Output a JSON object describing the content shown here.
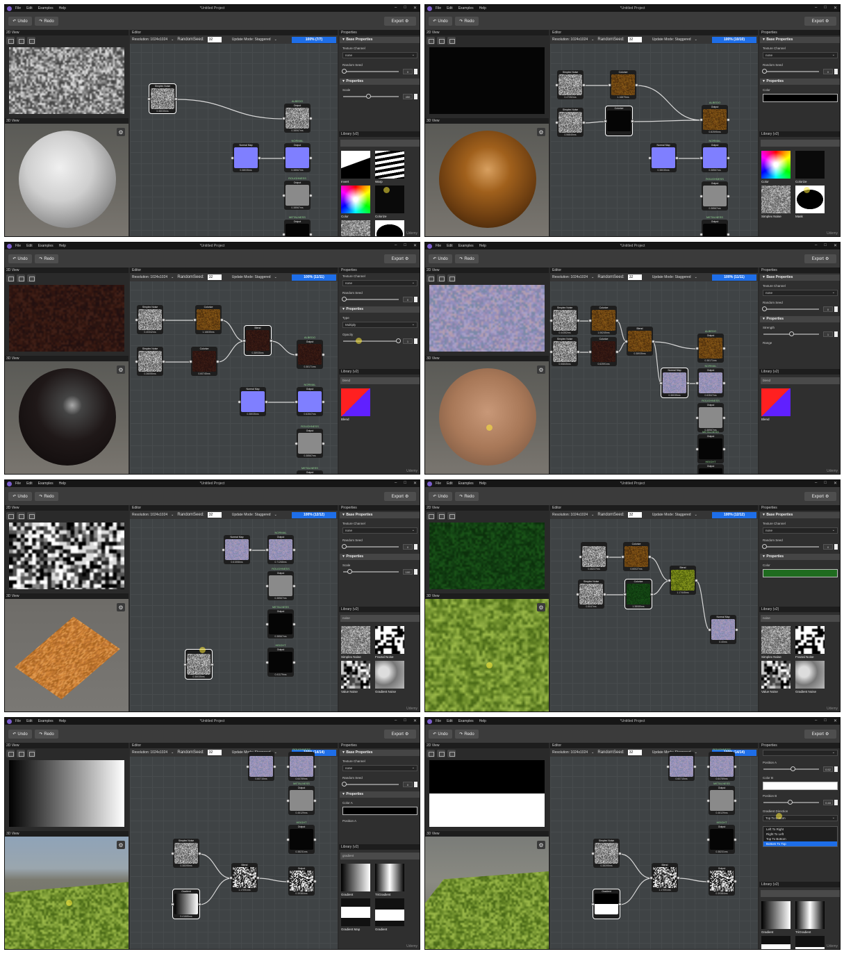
{
  "window": {
    "title": "*Untitled Project",
    "menu": [
      "File",
      "Edit",
      "Examples",
      "Help"
    ],
    "controls": [
      "–",
      "□",
      "✕"
    ]
  },
  "toolbar": {
    "undo_label": "Undo",
    "redo_label": "Redo",
    "export_label": "Export"
  },
  "sections": {
    "view2d": "2D View",
    "view3d": "3D View",
    "editor": "Editor",
    "properties": "Properties",
    "library": "Library (v2)"
  },
  "editor_bar": {
    "resolution": "Resolution: 1024x1024",
    "seed_label": "RandomSeed:",
    "seed_value": "32",
    "update_mode": "Update Mode: Staggered"
  },
  "watermark": "Udemy",
  "colors": {
    "accent_blue": "#1e6ee8",
    "normal_blue": "#7f7fff",
    "editor_bg": "#3f4345",
    "panel_bg": "#2b2b2b"
  },
  "panels": [
    {
      "progress": "100% (7/7)",
      "tex": "noise-gray",
      "sphere": "sphere-white",
      "model": "sphere",
      "props": [
        {
          "t": "sec",
          "label": "▼ Base Properties"
        },
        {
          "t": "lbl",
          "label": "Texture Channel"
        },
        {
          "t": "drop",
          "value": "none"
        },
        {
          "t": "lbl",
          "label": "Random Seed"
        },
        {
          "t": "slider",
          "value": "0",
          "f": 0.0
        },
        {
          "t": "sec",
          "label": "▼ Properties"
        },
        {
          "t": "lbl",
          "label": "Scale"
        },
        {
          "t": "slider",
          "value": "450",
          "f": 0.45
        }
      ],
      "library": {
        "search": "",
        "items": [
          {
            "label": "Invert",
            "thumb": "invert-thumb"
          },
          {
            "label": "Warp",
            "thumb": "warp-thumb"
          },
          {
            "label": "Color",
            "thumb": "color-wheel-thumb"
          },
          {
            "label": "Colorize",
            "thumb": "colorize-thumb"
          },
          {
            "label": "",
            "thumb": "noise-thumb"
          },
          {
            "label": "",
            "thumb": "mask-thumb"
          }
        ]
      },
      "cursor": "library",
      "nodes": [
        {
          "title": "Simplex Noise",
          "value": "0.38035ms",
          "preview": "noise-gray",
          "sel": true
        },
        {
          "title": "Output",
          "value": "0.38567ms",
          "preview": "noise-gray",
          "label": "ALBEDO"
        },
        {
          "title": "Normal Map",
          "value": "0.38035ms",
          "preview": "normal-blue"
        },
        {
          "title": "Output",
          "value": "0.38567ms",
          "preview": "normal-blue",
          "label": "NORMAL"
        },
        {
          "title": "Output",
          "value": "0.38567ms",
          "preview": "gray",
          "label": "ROUGHNESS"
        },
        {
          "title": "Output",
          "value": "",
          "preview": "black",
          "label": "METALNESS"
        }
      ]
    },
    {
      "progress": "100% (10/10)",
      "tex": "black",
      "sphere": "sphere-brown",
      "model": "sphere",
      "props": [
        {
          "t": "sec",
          "label": "▼ Base Properties"
        },
        {
          "t": "lbl",
          "label": "Texture Channel"
        },
        {
          "t": "drop",
          "value": "none"
        },
        {
          "t": "lbl",
          "label": "Random Seed"
        },
        {
          "t": "slider",
          "value": "0",
          "f": 0.0
        },
        {
          "t": "sec",
          "label": "▼ Properties"
        },
        {
          "t": "lbl",
          "label": "Color"
        },
        {
          "t": "color",
          "value": "#000000"
        }
      ],
      "library": {
        "search": "",
        "items": [
          {
            "label": "Color",
            "thumb": "color-wheel-thumb"
          },
          {
            "label": "Colorize",
            "thumb": "colorize-thumb"
          },
          {
            "label": "Simplex Noise",
            "thumb": "noise-thumb"
          },
          {
            "label": "Mask",
            "thumb": "mask-thumb"
          }
        ]
      },
      "cursor": "library",
      "nodes": [
        {
          "title": "Simplex Noise",
          "value": "0.47352ms",
          "preview": "noise-gray"
        },
        {
          "title": "Colorize",
          "value": "1.16879ms",
          "preview": "brown"
        },
        {
          "title": "Simplex Noise",
          "value": "0.56845ms",
          "preview": "noise-gray"
        },
        {
          "title": "Colorize",
          "value": "",
          "preview": "black",
          "sel": true
        },
        {
          "title": "Output",
          "value": "0.82595ms",
          "preview": "brown",
          "label": "ALBEDO"
        },
        {
          "title": "Normal Map",
          "value": "0.38035ms",
          "preview": "normal-blue"
        },
        {
          "title": "Output",
          "value": "0.38567ms",
          "preview": "normal-blue",
          "label": "NORMAL"
        },
        {
          "title": "Output",
          "value": "0.38567ms",
          "preview": "gray",
          "label": "ROUGHNESS"
        },
        {
          "title": "Output",
          "value": "",
          "preview": "black",
          "label": "METALNESS"
        }
      ]
    },
    {
      "progress": "100% (11/11)",
      "tex": "dark-red",
      "sphere": "sphere-dark",
      "model": "sphere",
      "props": [
        {
          "t": "lbl",
          "label": "Texture Channel"
        },
        {
          "t": "drop",
          "value": "none"
        },
        {
          "t": "lbl",
          "label": "Random Seed"
        },
        {
          "t": "slider",
          "value": "0",
          "f": 0.0
        },
        {
          "t": "sec",
          "label": "▼ Properties"
        },
        {
          "t": "lbl",
          "label": "Type"
        },
        {
          "t": "drop",
          "value": "Multiply"
        },
        {
          "t": "lbl",
          "label": "Opacity"
        },
        {
          "t": "slider",
          "value": "1",
          "f": 1.0
        }
      ],
      "library": {
        "search": "blend",
        "items": [
          {
            "label": "Blend",
            "thumb": "blend-thumb"
          }
        ]
      },
      "cursor": "props",
      "nodes": [
        {
          "title": "Simplex Noise",
          "value": "0.40342ms",
          "preview": "noise-gray"
        },
        {
          "title": "Colorize",
          "value": "1.16835ms",
          "preview": "brown"
        },
        {
          "title": "Blend",
          "value": "0.38935ms",
          "preview": "dark-red",
          "sel": true
        },
        {
          "title": "Output",
          "value": "0.38171ms",
          "preview": "dark-red",
          "label": "ALBEDO"
        },
        {
          "title": "Simplex Noise",
          "value": "0.36055ms",
          "preview": "noise-gray"
        },
        {
          "title": "Colorize",
          "value": "0.60745ms",
          "preview": "dark-red"
        },
        {
          "title": "Normal Map",
          "value": "0.38035ms",
          "preview": "normal-blue"
        },
        {
          "title": "Output",
          "value": "0.62847ms",
          "preview": "normal-blue",
          "label": "NORMAL"
        },
        {
          "title": "Output",
          "value": "0.38567ms",
          "preview": "gray",
          "label": "ROUGHNESS"
        },
        {
          "title": "Output",
          "value": "",
          "preview": "black",
          "label": "METALNESS"
        }
      ]
    },
    {
      "progress": "100% (11/11)",
      "tex": "noise-color",
      "sphere": "sphere-sand",
      "model": "sphere",
      "props": [
        {
          "t": "sec",
          "label": "▼ Base Properties"
        },
        {
          "t": "lbl",
          "label": "Texture Channel"
        },
        {
          "t": "drop",
          "value": "none"
        },
        {
          "t": "lbl",
          "label": "Random Seed"
        },
        {
          "t": "slider",
          "value": "0",
          "f": 0.0
        },
        {
          "t": "sec",
          "label": "▼ Properties"
        },
        {
          "t": "lbl",
          "label": "Strength"
        },
        {
          "t": "slider",
          "value": "1",
          "f": 0.5
        },
        {
          "t": "lbl",
          "label": "Range"
        }
      ],
      "library": {
        "search": "blend",
        "items": [
          {
            "label": "Blend",
            "thumb": "blend-thumb"
          }
        ]
      },
      "cursor": "view3d",
      "nodes": [
        {
          "title": "Simplex Noise",
          "value": "0.44352ms",
          "preview": "noise-gray"
        },
        {
          "title": "Colorize",
          "value": "1.06245ms",
          "preview": "brown"
        },
        {
          "title": "Simplex Noise",
          "value": "0.56845ms",
          "preview": "noise-gray"
        },
        {
          "title": "Colorize",
          "value": "0.62591ms",
          "preview": "dark-red"
        },
        {
          "title": "Blend",
          "value": "0.38935ms",
          "preview": "brown"
        },
        {
          "title": "Output",
          "value": "0.38171ms",
          "preview": "brown",
          "label": "ALBEDO"
        },
        {
          "title": "Normal Map",
          "value": "0.38035ms",
          "preview": "noise-color",
          "sel": true
        },
        {
          "title": "Output",
          "value": "0.62847ms",
          "preview": "noise-color",
          "label": "NORMAL"
        },
        {
          "title": "Output",
          "value": "0.38567ms",
          "preview": "gray",
          "label": "ROUGHNESS"
        },
        {
          "title": "Output",
          "value": "",
          "preview": "black",
          "label": "METALNESS"
        },
        {
          "title": "Output",
          "value": "",
          "preview": "black",
          "label": "HEIGHT"
        }
      ]
    },
    {
      "progress": "100% (12/12)",
      "tex": "noise-bw",
      "sphere": "plane-orange",
      "model": "plane",
      "props": [
        {
          "t": "sec",
          "label": "▼ Base Properties"
        },
        {
          "t": "lbl",
          "label": "Texture Channel"
        },
        {
          "t": "drop",
          "value": "none"
        },
        {
          "t": "lbl",
          "label": "Random Seed"
        },
        {
          "t": "slider",
          "value": "0",
          "f": 0.0
        },
        {
          "t": "sec",
          "label": "▼ Properties"
        },
        {
          "t": "lbl",
          "label": "Scale"
        },
        {
          "t": "slider",
          "value": "100",
          "f": 0.1
        }
      ],
      "library": {
        "search": "noise",
        "items": [
          {
            "label": "Simplex Noise",
            "thumb": "noise-thumb"
          },
          {
            "label": "Fractal Noise",
            "thumb": "fractal-thumb"
          },
          {
            "label": "Value Noise",
            "thumb": "value-thumb"
          },
          {
            "label": "Gradient Noise",
            "thumb": "gradnoise-thumb"
          }
        ]
      },
      "cursor": "editor",
      "nodes": [
        {
          "title": "Normal Map",
          "value": "0.61558ms",
          "preview": "noise-color"
        },
        {
          "title": "Output",
          "value": "0.71268ms",
          "preview": "noise-color",
          "label": "NORMAL"
        },
        {
          "title": "Output",
          "value": "0.38567ms",
          "preview": "gray",
          "label": "ROUGHNESS"
        },
        {
          "title": "Output",
          "value": "0.38567ms",
          "preview": "black",
          "label": "METALNESS"
        },
        {
          "title": "Output",
          "value": "0.41179ms",
          "preview": "black",
          "label": "HEIGHT"
        },
        {
          "title": "",
          "value": "0.38035ms",
          "preview": "noise-gray",
          "sel": true
        }
      ]
    },
    {
      "progress": "100% (12/12)",
      "tex": "dark-green",
      "sphere": "plane-grass",
      "model": "plane",
      "props": [
        {
          "t": "sec",
          "label": "▼ Base Properties"
        },
        {
          "t": "lbl",
          "label": "Texture Channel"
        },
        {
          "t": "drop",
          "value": "none"
        },
        {
          "t": "lbl",
          "label": "Random Seed"
        },
        {
          "t": "slider",
          "value": "0",
          "f": 0.0
        },
        {
          "t": "sec",
          "label": "▼ Properties"
        },
        {
          "t": "lbl",
          "label": "Color"
        },
        {
          "t": "color",
          "value": "#1f6b1f"
        }
      ],
      "library": {
        "search": "noise",
        "items": [
          {
            "label": "Simplex Noise",
            "thumb": "noise-thumb"
          },
          {
            "label": "Fractal Noise",
            "thumb": "fractal-thumb"
          },
          {
            "label": "Value Noise",
            "thumb": "value-thumb"
          },
          {
            "label": "Gradient Noise",
            "thumb": "gradnoise-thumb"
          }
        ]
      },
      "cursor": "view3d",
      "nodes": [
        {
          "title": "",
          "value": "0.46227ms",
          "preview": "noise-gray"
        },
        {
          "title": "Colorize",
          "value": "0.60027ms",
          "preview": "brown"
        },
        {
          "title": "Simplex Noise",
          "value": "0.5047ms",
          "preview": "noise-gray"
        },
        {
          "title": "Colorize",
          "value": "1.38089ms",
          "preview": "dark-green",
          "sel": true
        },
        {
          "title": "Blend",
          "value": "1.17445ms",
          "preview": "olive"
        },
        {
          "title": "Normal Map",
          "value": "0.40ms",
          "preview": "noise-color"
        }
      ]
    },
    {
      "progress": "100% (14/14)",
      "tex": "gradient-lr",
      "sphere": "plane-grass-bg",
      "model": "plane",
      "props": [
        {
          "t": "sec",
          "label": "▼ Base Properties"
        },
        {
          "t": "lbl",
          "label": "Texture Channel"
        },
        {
          "t": "drop",
          "value": "none"
        },
        {
          "t": "lbl",
          "label": "Random Seed"
        },
        {
          "t": "slider",
          "value": "0",
          "f": 0.0
        },
        {
          "t": "sec",
          "label": "▼ Properties"
        },
        {
          "t": "lbl",
          "label": "Color A"
        },
        {
          "t": "color",
          "value": "#000000"
        },
        {
          "t": "lbl",
          "label": "Position A"
        }
      ],
      "library": {
        "search": "gradient",
        "items": [
          {
            "label": "Gradient",
            "thumb": "gradient-thumb"
          },
          {
            "label": "TriGradient",
            "thumb": "trigradient-thumb"
          },
          {
            "label": "Gradient Map",
            "thumb": "gradmap-thumb"
          },
          {
            "label": "Gradient",
            "thumb": "gradient2-thumb"
          }
        ]
      },
      "cursor": "view3d",
      "nodes": [
        {
          "title": "",
          "value": "0.60715ms",
          "preview": "noise-color"
        },
        {
          "title": "",
          "value": "0.64789ms",
          "preview": "noise-color",
          "label": "ROUGHNESS"
        },
        {
          "title": "Output",
          "value": "0.46129ms",
          "preview": "gray",
          "label": "METALNESS"
        },
        {
          "title": "Output",
          "value": "0.38231ms",
          "preview": "black",
          "label": "HEIGHT"
        },
        {
          "title": "Output",
          "value": "0.39384ms",
          "preview": "noise-bw"
        },
        {
          "title": "Simplex Noise",
          "value": "0.38395ms",
          "preview": "noise-gray"
        },
        {
          "title": "Blend",
          "value": "1.17091ms",
          "preview": "noise-bw"
        },
        {
          "title": "Gradient",
          "value": "0.41885ms",
          "preview": "gradient-lr",
          "sel": true
        }
      ]
    },
    {
      "progress": "100% (14/14)",
      "tex": "gradient-tb",
      "sphere": "plane-grass-bg2",
      "model": "plane",
      "props": [
        {
          "t": "drop",
          "value": ""
        },
        {
          "t": "lbl",
          "label": "Position A"
        },
        {
          "t": "slider",
          "value": "0.52",
          "f": 0.52
        },
        {
          "t": "lbl",
          "label": "Color B"
        },
        {
          "t": "color",
          "value": "#ffffff"
        },
        {
          "t": "lbl",
          "label": "Position B"
        },
        {
          "t": "slider",
          "value": "0.48",
          "f": 0.48
        },
        {
          "t": "lbl",
          "label": "Gradient Direction"
        },
        {
          "t": "drop",
          "value": "Top To Bottom"
        },
        {
          "t": "list",
          "options": [
            "Left To Right",
            "Right To Left",
            "Top To Bottom",
            "Bottom To Top"
          ],
          "hl": 3
        }
      ],
      "library": {
        "search": "",
        "items": [
          {
            "label": "Gradient",
            "thumb": "gradient-thumb"
          },
          {
            "label": "TriGradient",
            "thumb": "trigradient-thumb"
          },
          {
            "label": "Gradient Map",
            "thumb": "gradmap-thumb"
          },
          {
            "label": "Gradient",
            "thumb": "gradient2-thumb"
          }
        ]
      },
      "cursor": "props",
      "nodes": [
        {
          "title": "",
          "value": "0.60715ms",
          "preview": "noise-color"
        },
        {
          "title": "",
          "value": "0.64789ms",
          "preview": "noise-color",
          "label": "ROUGHNESS"
        },
        {
          "title": "Output",
          "value": "0.46129ms",
          "preview": "gray",
          "label": "METALNESS"
        },
        {
          "title": "Output",
          "value": "0.38231ms",
          "preview": "black",
          "label": "HEIGHT"
        },
        {
          "title": "Output",
          "value": "0.39384ms",
          "preview": "noise-bw"
        },
        {
          "title": "Simplex Noise",
          "value": "0.38395ms",
          "preview": "noise-gray"
        },
        {
          "title": "Blend",
          "value": "1.17091ms",
          "preview": "noise-bw"
        },
        {
          "title": "Gradient",
          "value": "",
          "preview": "gradient-tb",
          "sel": true
        }
      ]
    }
  ]
}
